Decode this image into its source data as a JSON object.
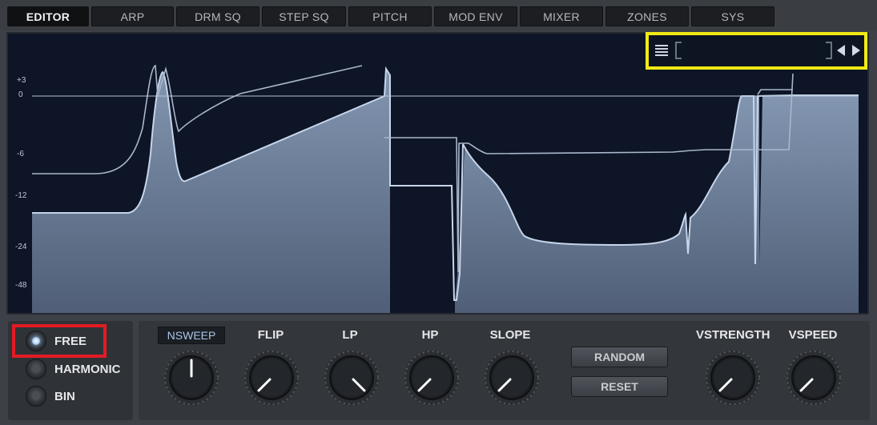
{
  "tabs": [
    {
      "label": "EDITOR",
      "active": true
    },
    {
      "label": "ARP",
      "active": false
    },
    {
      "label": "DRM SQ",
      "active": false
    },
    {
      "label": "STEP SQ",
      "active": false
    },
    {
      "label": "PITCH",
      "active": false
    },
    {
      "label": "MOD ENV",
      "active": false
    },
    {
      "label": "MIXER",
      "active": false
    },
    {
      "label": "ZONES",
      "active": false
    },
    {
      "label": "SYS",
      "active": false
    }
  ],
  "display": {
    "db_labels": [
      "+3",
      "0",
      "-6",
      "-12",
      "-24",
      "-48"
    ],
    "preset_browser": {
      "menu_icon": "list-menu-icon",
      "preset_name": "",
      "prev_icon": "triangle-left-icon",
      "next_icon": "triangle-right-icon",
      "highlight_color": "#f2ea15"
    }
  },
  "modes": {
    "items": [
      {
        "label": "FREE",
        "selected": true
      },
      {
        "label": "HARMONIC",
        "selected": false
      },
      {
        "label": "BIN",
        "selected": false
      }
    ],
    "highlight_color": "#e21b24"
  },
  "knobs": [
    {
      "label": "NSWEEP",
      "boxed": true
    },
    {
      "label": "FLIP",
      "boxed": false
    },
    {
      "label": "LP",
      "boxed": false
    },
    {
      "label": "HP",
      "boxed": false
    },
    {
      "label": "SLOPE",
      "boxed": false
    },
    {
      "label": "VSTRENGTH",
      "boxed": false
    },
    {
      "label": "VSPEED",
      "boxed": false
    }
  ],
  "buttons": {
    "random": "RANDOM",
    "reset": "RESET"
  },
  "colors": {
    "curve": "#b8c8e0",
    "fill": "#5d6e88",
    "indicator": "#ffffff"
  }
}
